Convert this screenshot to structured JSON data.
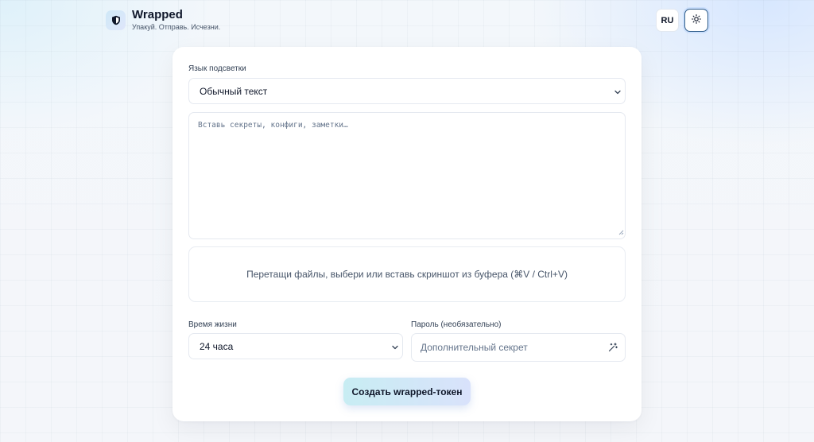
{
  "header": {
    "title": "Wrapped",
    "subtitle": "Упакуй. Отправь. Исчезни.",
    "logo_icon": "shield-icon",
    "lang_label": "RU",
    "theme_icon": "sun-icon"
  },
  "form": {
    "highlight": {
      "label": "Язык подсветки",
      "selected": "Обычный текст"
    },
    "content": {
      "placeholder": "Вставь секреты, конфиги, заметки…"
    },
    "dropzone": {
      "text": "Перетащи файлы, выбери или вставь скриншот из буфера (⌘V / Ctrl+V)"
    },
    "ttl": {
      "label": "Время жизни",
      "selected": "24 часа"
    },
    "password": {
      "label": "Пароль (необязательно)",
      "placeholder": "Дополнительный секрет",
      "generate_icon": "magic-wand-icon"
    },
    "submit_label": "Создать wrapped-токен"
  },
  "colors": {
    "accent_border": "#2f5d8a",
    "text_primary": "#0f172a",
    "text_muted": "#475569"
  }
}
